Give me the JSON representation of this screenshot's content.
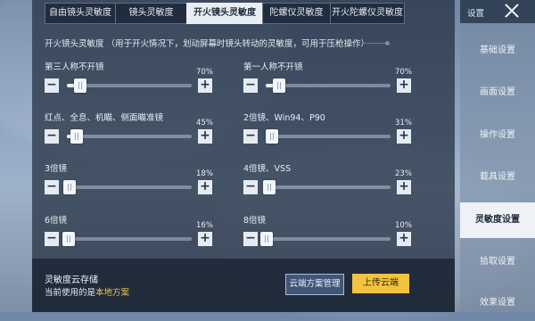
{
  "tabs": [
    {
      "label": "自由镜头灵敏度"
    },
    {
      "label": "镜头灵敏度"
    },
    {
      "label": "开火镜头灵敏度"
    },
    {
      "label": "陀螺仪灵敏度"
    },
    {
      "label": "开火陀螺仪灵敏度"
    }
  ],
  "description": "开火镜头灵敏度 （用于开火情况下，划动屏幕时镜头转动的灵敏度，可用于压枪操作）",
  "sliders": [
    {
      "label": "第三人称不开镜",
      "value": "70%",
      "fraction": 0.11
    },
    {
      "label": "第一人称不开镜",
      "value": "70%",
      "fraction": 0.11
    },
    {
      "label": "红点、全息、机瞄、侧面瞄准镜",
      "value": "45%",
      "fraction": 0.08
    },
    {
      "label": "2倍镜、Win94、P90",
      "value": "31%",
      "fraction": 0.05
    },
    {
      "label": "3倍镜",
      "value": "18%",
      "fraction": 0.02
    },
    {
      "label": "4倍镜、VSS",
      "value": "23%",
      "fraction": 0.03
    },
    {
      "label": "6倍镜",
      "value": "16%",
      "fraction": 0.015
    },
    {
      "label": "8倍镜",
      "value": "10%",
      "fraction": 0.01
    }
  ],
  "controls": {
    "minus": "−",
    "plus": "+"
  },
  "footer": {
    "title": "灵敏度云存储",
    "current_prefix": "当前使用的是",
    "current_value": "本地方案",
    "manage_button": "云端方案管理",
    "upload_button": "上传云端"
  },
  "sidebar": {
    "header": "设置",
    "items": [
      {
        "label": "基础设置"
      },
      {
        "label": "画面设置"
      },
      {
        "label": "操作设置"
      },
      {
        "label": "载具设置"
      },
      {
        "label": "灵敏度设置"
      },
      {
        "label": "拾取设置"
      },
      {
        "label": "效果设置"
      }
    ],
    "active_index": 4
  },
  "colors": {
    "accent": "#f2c33f",
    "active_tab_bg": "#e9edf3",
    "highlight_text": "#f3c04a"
  },
  "icons": {
    "close": "close-icon",
    "minus": "minus-icon",
    "plus": "plus-icon"
  }
}
